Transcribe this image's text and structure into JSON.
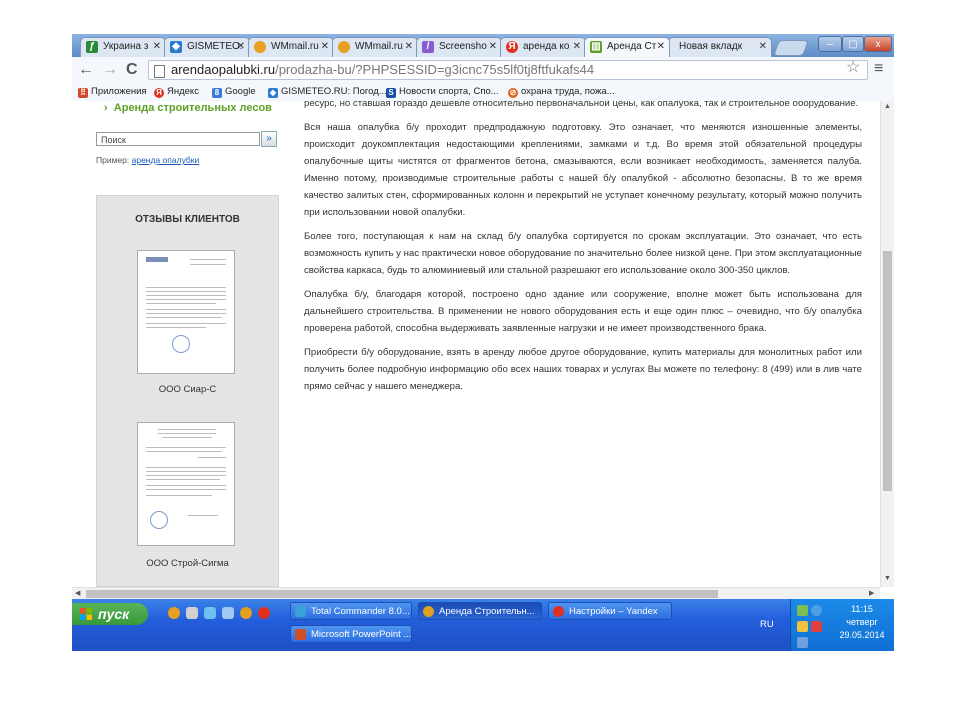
{
  "tabs": [
    {
      "label": "Украина з",
      "icon": "weather-icon",
      "color": "#2a8c3a"
    },
    {
      "label": "GISMETEO.",
      "icon": "gismeteo-icon",
      "color": "#2a7bd0"
    },
    {
      "label": "WMmail.ru",
      "icon": "wmmail-icon",
      "color": "#e8a020"
    },
    {
      "label": "WMmail.ru",
      "icon": "wmmail-icon",
      "color": "#e8a020"
    },
    {
      "label": "Screensho",
      "icon": "screenshot-icon",
      "color": "#8a5bd0"
    },
    {
      "label": "аренда ко",
      "icon": "yandex-icon",
      "color": "#e03020"
    },
    {
      "label": "Аренда Ст",
      "icon": "site-icon",
      "color": "#5ea027"
    },
    {
      "label": "Новая вкладк",
      "icon": "newtab-page-icon",
      "color": "#dddddd"
    }
  ],
  "toolbar": {
    "url_domain": "arendaopalubki.ru",
    "url_path": "/prodazha-bu/?PHPSESSID=g3icnc75s5lf0tj8ftfukafs44",
    "back": "←",
    "forward": "→",
    "reload": "C",
    "star": "☆",
    "menu": "≡"
  },
  "bookmarks": [
    {
      "label": "Приложения",
      "icon": "apps-icon",
      "color": "#d04a2a"
    },
    {
      "label": "Яндекс",
      "icon": "yandex-icon",
      "color": "#e03020"
    },
    {
      "label": "Google",
      "icon": "google-icon",
      "color": "#3a7ad8"
    },
    {
      "label": "GISMETEO.RU: Погод...",
      "icon": "gismeteo-icon",
      "color": "#2a7bd0"
    },
    {
      "label": "Новости спорта, Спо...",
      "icon": "sport-icon",
      "color": "#1a4fa8"
    },
    {
      "label": "охрана труда, пожа...",
      "icon": "safety-icon",
      "color": "#e06020"
    }
  ],
  "sidebar": {
    "link": "Аренда строительных лесов",
    "search_placeholder": "Поиск",
    "search_button": "»",
    "example_prefix": "Пример:",
    "example_link": "аренда опалубки",
    "reviews_title": "ОТЗЫВЫ КЛИЕНТОВ",
    "reviews": [
      {
        "caption": "ООО Сиар-С"
      },
      {
        "caption": "ООО Строй-Сигма"
      }
    ]
  },
  "content": {
    "paragraphs": [
      "ресурс, но ставшая гораздо дешевле относительно первоначальной цены, как опалубка, так и строительное оборудование.",
      "Вся наша опалубка б/у проходит предпродажную подготовку. Это означает, что меняются изношенные элементы, происходит доукомплектация недостающими креплениями, замками и т.д. Во время этой обязательной процедуры опалубочные щиты чистятся от фрагментов бетона, смазываются, если возникает необходимость, заменяется палуба.  Именно потому, производимые строительные работы с нашей б/у опалубкой - абсолютно безопасны. В то же время качество залитых стен, сформированных колонн и перекрытий не уступает конечному результату, который можно получить при использовании новой опалубки.",
      "Более того, поступающая к нам на склад б/у опалубка сортируется по срокам эксплуатации. Это означает, что есть возможность купить у нас практически новое оборудование по значительно более низкой цене. При этом эксплуатационные свойства каркаса, будь то алюминиевый или стальной разрешают его использование около 300-350 циклов.",
      "Опалубка б/у, благодаря которой, построено одно здание или сооружение, вполне может быть использована для дальнейшего строительства. В применении не нового оборудования есть и еще один плюс – очевидно, что б/у опалубка проверена работой, способна выдерживать заявленные нагрузки и не имеет производственного брака.",
      "Приобрести б/у оборудование, взять в аренду любое другое оборудование, купить материалы для монолитных работ или получить более подробную информацию обо всех наших товарах и услугах Вы можете по телефону: 8 (499) или в лив чате прямо сейчас у нашего менеджера."
    ]
  },
  "taskbar": {
    "start": "пуск",
    "buttons": [
      {
        "label": "Total Commander 8.0...",
        "icon": "total-commander-icon",
        "color": "#3aa0d8"
      },
      {
        "label": "Аренда Строительн...",
        "icon": "chrome-icon",
        "color": "#e0a020"
      },
      {
        "label": "Настройки – Yandex",
        "icon": "yandex-browser-icon",
        "color": "#e03020"
      },
      {
        "label": "Microsoft PowerPoint ...",
        "icon": "powerpoint-icon",
        "color": "#d0502a"
      }
    ],
    "lang": "RU",
    "time": "11:15",
    "day": "четверг",
    "date": "29.05.2014"
  },
  "window_buttons": {
    "minimize": "–",
    "maximize": "▢",
    "close": "x"
  }
}
